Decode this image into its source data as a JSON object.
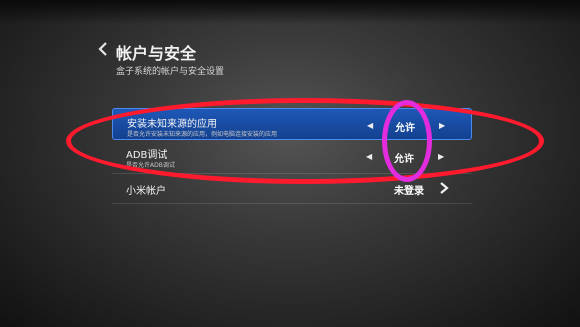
{
  "header": {
    "title": "帐户与安全",
    "subtitle": "盒子系统的帐户与安全设置"
  },
  "settings": [
    {
      "label": "安装未知来源的应用",
      "description": "是否允许安装未知来源的应用，例如电脑连接安装的应用",
      "value": "允许",
      "selected": true
    },
    {
      "label": "ADB调试",
      "description": "是否允许ADB调试",
      "value": "允许",
      "selected": false
    },
    {
      "label": "小米帐户",
      "value": "未登录",
      "selected": false
    }
  ],
  "icons": {
    "back": "chevron-left-icon",
    "option_prev": "arrow-left-icon",
    "option_next": "arrow-right-icon",
    "enter": "chevron-right-icon"
  },
  "colors": {
    "selected_row": "#1e58b8",
    "annotation_red": "#ff1a2e",
    "annotation_magenta": "#e22cde"
  }
}
